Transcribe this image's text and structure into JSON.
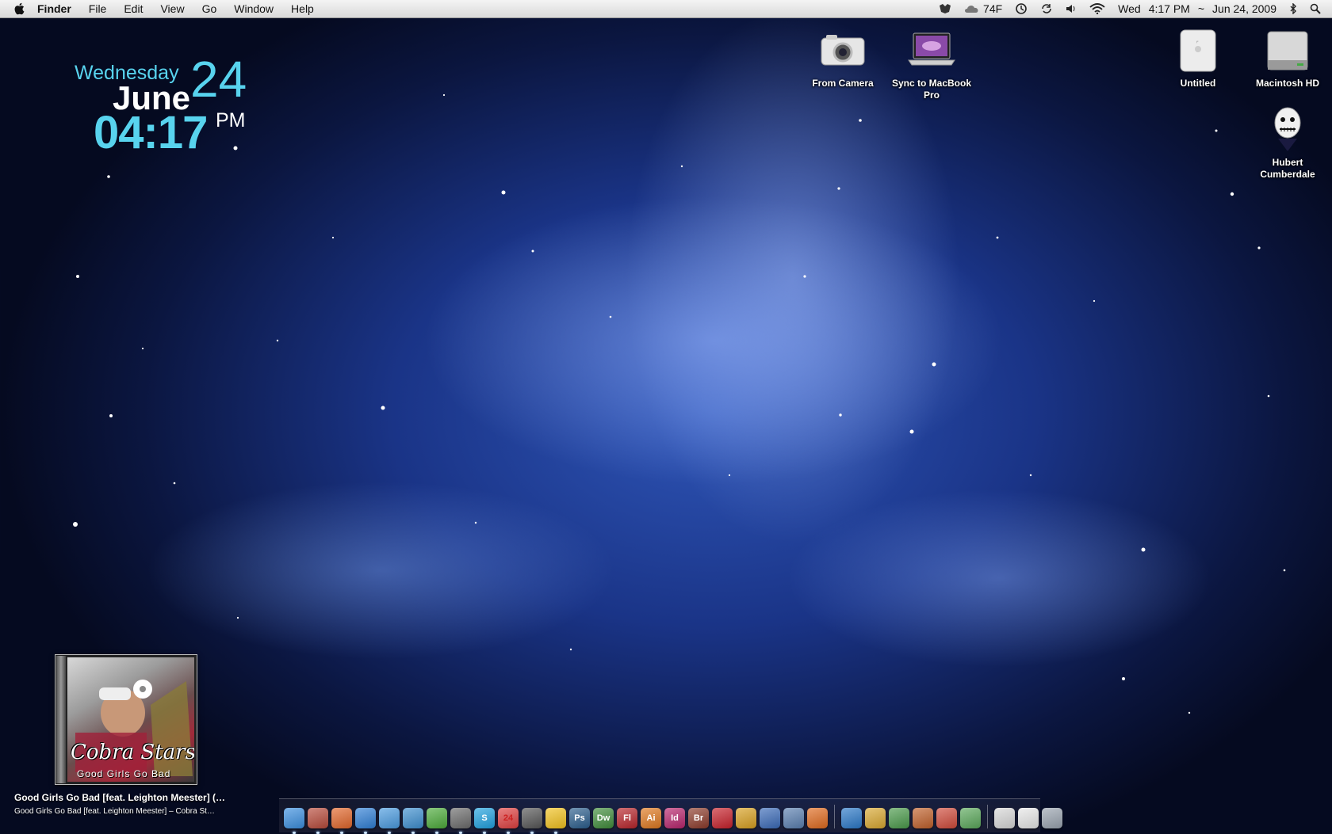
{
  "menubar": {
    "app_name": "Finder",
    "menus": [
      "File",
      "Edit",
      "View",
      "Go",
      "Window",
      "Help"
    ],
    "weather": "74F",
    "day": "Wed",
    "time": "4:17 PM",
    "separator": "~",
    "date": "Jun 24, 2009"
  },
  "clock_widget": {
    "weekday": "Wednesday",
    "day": "24",
    "month": "June",
    "time": "04:17",
    "ampm": "PM"
  },
  "desktop_icons": [
    {
      "label": "From Camera"
    },
    {
      "label": "Sync to MacBook Pro"
    },
    {
      "label": "Untitled"
    },
    {
      "label": "Macintosh HD"
    },
    {
      "label": "Hubert Cumberdale"
    }
  ],
  "now_playing": {
    "album_band": "Cobra Starship",
    "album_title": "Good Girls Go Bad",
    "track": "Good Girls Go Bad [feat. Leighton Meester] (…",
    "subtitle": "Good Girls Go Bad [feat. Leighton Meester] – Cobra St…"
  },
  "dock": {
    "items": [
      {
        "name": "finder",
        "label": "",
        "color": "#3b8fe0"
      },
      {
        "name": "mail",
        "label": "",
        "color": "#b84a3a"
      },
      {
        "name": "firefox",
        "label": "",
        "color": "#e2662a"
      },
      {
        "name": "safari",
        "label": "",
        "color": "#2f7fd6"
      },
      {
        "name": "itunes",
        "label": "",
        "color": "#4a9be0"
      },
      {
        "name": "tweetie",
        "label": "",
        "color": "#3d8fd0"
      },
      {
        "name": "adium",
        "label": "",
        "color": "#4cab3a"
      },
      {
        "name": "mail-stamp",
        "label": "",
        "color": "#6b6b6b"
      },
      {
        "name": "skype",
        "label": "S",
        "color": "#1fa2e0"
      },
      {
        "name": "ical",
        "label": "24",
        "color": "#e04040"
      },
      {
        "name": "transmission",
        "label": "",
        "color": "#555"
      },
      {
        "name": "cyberduck",
        "label": "",
        "color": "#f2c21e"
      },
      {
        "name": "photoshop",
        "label": "Ps",
        "color": "#2a5d8c"
      },
      {
        "name": "dreamweaver",
        "label": "Dw",
        "color": "#3f8c3a"
      },
      {
        "name": "flash",
        "label": "Fl",
        "color": "#b8242a"
      },
      {
        "name": "illustrator",
        "label": "Ai",
        "color": "#e0781e"
      },
      {
        "name": "indesign",
        "label": "Id",
        "color": "#b8246c"
      },
      {
        "name": "bridge",
        "label": "Br",
        "color": "#8c3a2a"
      },
      {
        "name": "acrobat",
        "label": "",
        "color": "#c8202a"
      },
      {
        "name": "fireworks",
        "label": "",
        "color": "#d8a020"
      },
      {
        "name": "xcode",
        "label": "",
        "color": "#3a6ab8"
      },
      {
        "name": "preview",
        "label": "",
        "color": "#5a7fb0"
      },
      {
        "name": "rss",
        "label": "",
        "color": "#e06a1e"
      },
      {
        "name": "bird-app",
        "label": "",
        "color": "#2a78c8"
      },
      {
        "name": "script-editor",
        "label": "",
        "color": "#d9a830"
      },
      {
        "name": "network",
        "label": "",
        "color": "#4a9a4a"
      },
      {
        "name": "cube-app",
        "label": "",
        "color": "#c0602a"
      },
      {
        "name": "umbrella-app",
        "label": "",
        "color": "#d04a3a"
      },
      {
        "name": "contacts",
        "label": "",
        "color": "#5aa85a"
      },
      {
        "name": "doc-1",
        "label": "",
        "color": "#d8d8d8"
      },
      {
        "name": "doc-2",
        "label": "",
        "color": "#e8e8e8"
      },
      {
        "name": "trash",
        "label": "",
        "color": "#9aa4b0"
      }
    ]
  }
}
